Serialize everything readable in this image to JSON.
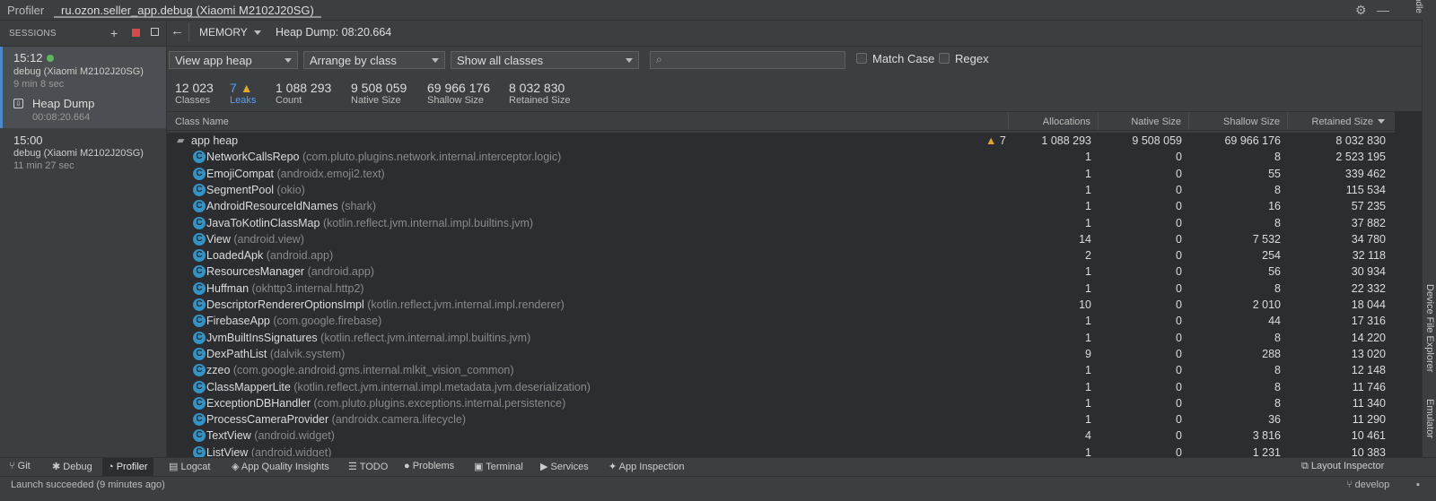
{
  "window": {
    "app_title": "Profiler",
    "tab_title": "ru.ozon.seller_app.debug (Xiaomi M2102J20SG)",
    "right_strip_top": "adle"
  },
  "sessions": {
    "header": "SESSIONS",
    "items": [
      {
        "time": "15:12",
        "device": "debug (Xiaomi M2102J20SG)",
        "duration": "9 min 8 sec",
        "artifact": {
          "label": "Heap Dump",
          "time": "00:08:20.664"
        }
      },
      {
        "time": "15:00",
        "device": "debug (Xiaomi M2102J20SG)",
        "duration": "11 min 27 sec"
      }
    ]
  },
  "toolbar": {
    "profiler_selector": "MEMORY",
    "heap_dump_title": "Heap Dump: 08:20.664"
  },
  "filters": {
    "heap_select": "View app heap",
    "arrange_select": "Arrange by class",
    "classes_select": "Show all classes",
    "search_placeholder": "",
    "match_case": "Match Case",
    "regex": "Regex"
  },
  "stats": [
    {
      "value": "12 023",
      "label": "Classes"
    },
    {
      "value": "7",
      "label": "Leaks"
    },
    {
      "value": "1 088 293",
      "label": "Count"
    },
    {
      "value": "9 508 059",
      "label": "Native Size"
    },
    {
      "value": "69 966 176",
      "label": "Shallow Size"
    },
    {
      "value": "8 032 830",
      "label": "Retained Size"
    }
  ],
  "table": {
    "columns": [
      "Class Name",
      "Allocations",
      "Native Size",
      "Shallow Size",
      "Retained Size"
    ],
    "root": {
      "name": "app heap",
      "leaks": "7",
      "allocations": "1 088 293",
      "native": "9 508 059",
      "shallow": "69 966 176",
      "retained": "8 032 830"
    },
    "rows": [
      {
        "name": "NetworkCallsRepo",
        "pkg": "(com.pluto.plugins.network.internal.interceptor.logic)",
        "allocations": "1",
        "native": "0",
        "shallow": "8",
        "retained": "2 523 195"
      },
      {
        "name": "EmojiCompat",
        "pkg": "(androidx.emoji2.text)",
        "allocations": "1",
        "native": "0",
        "shallow": "55",
        "retained": "339 462"
      },
      {
        "name": "SegmentPool",
        "pkg": "(okio)",
        "allocations": "1",
        "native": "0",
        "shallow": "8",
        "retained": "115 534"
      },
      {
        "name": "AndroidResourceIdNames",
        "pkg": "(shark)",
        "allocations": "1",
        "native": "0",
        "shallow": "16",
        "retained": "57 235"
      },
      {
        "name": "JavaToKotlinClassMap",
        "pkg": "(kotlin.reflect.jvm.internal.impl.builtins.jvm)",
        "allocations": "1",
        "native": "0",
        "shallow": "8",
        "retained": "37 882"
      },
      {
        "name": "View",
        "pkg": "(android.view)",
        "allocations": "14",
        "native": "0",
        "shallow": "7 532",
        "retained": "34 780"
      },
      {
        "name": "LoadedApk",
        "pkg": "(android.app)",
        "allocations": "2",
        "native": "0",
        "shallow": "254",
        "retained": "32 118"
      },
      {
        "name": "ResourcesManager",
        "pkg": "(android.app)",
        "allocations": "1",
        "native": "0",
        "shallow": "56",
        "retained": "30 934"
      },
      {
        "name": "Huffman",
        "pkg": "(okhttp3.internal.http2)",
        "allocations": "1",
        "native": "0",
        "shallow": "8",
        "retained": "22 332"
      },
      {
        "name": "DescriptorRendererOptionsImpl",
        "pkg": "(kotlin.reflect.jvm.internal.impl.renderer)",
        "allocations": "10",
        "native": "0",
        "shallow": "2 010",
        "retained": "18 044"
      },
      {
        "name": "FirebaseApp",
        "pkg": "(com.google.firebase)",
        "allocations": "1",
        "native": "0",
        "shallow": "44",
        "retained": "17 316"
      },
      {
        "name": "JvmBuiltInsSignatures",
        "pkg": "(kotlin.reflect.jvm.internal.impl.builtins.jvm)",
        "allocations": "1",
        "native": "0",
        "shallow": "8",
        "retained": "14 220"
      },
      {
        "name": "DexPathList",
        "pkg": "(dalvik.system)",
        "allocations": "9",
        "native": "0",
        "shallow": "288",
        "retained": "13 020"
      },
      {
        "name": "zzeo",
        "pkg": "(com.google.android.gms.internal.mlkit_vision_common)",
        "allocations": "1",
        "native": "0",
        "shallow": "8",
        "retained": "12 148"
      },
      {
        "name": "ClassMapperLite",
        "pkg": "(kotlin.reflect.jvm.internal.impl.metadata.jvm.deserialization)",
        "allocations": "1",
        "native": "0",
        "shallow": "8",
        "retained": "11 746"
      },
      {
        "name": "ExceptionDBHandler",
        "pkg": "(com.pluto.plugins.exceptions.internal.persistence)",
        "allocations": "1",
        "native": "0",
        "shallow": "8",
        "retained": "11 340"
      },
      {
        "name": "ProcessCameraProvider",
        "pkg": "(androidx.camera.lifecycle)",
        "allocations": "1",
        "native": "0",
        "shallow": "36",
        "retained": "11 290"
      },
      {
        "name": "TextView",
        "pkg": "(android.widget)",
        "allocations": "4",
        "native": "0",
        "shallow": "3 816",
        "retained": "10 461"
      },
      {
        "name": "ListView",
        "pkg": "(android.widget)",
        "allocations": "1",
        "native": "0",
        "shallow": "1 231",
        "retained": "10 383"
      }
    ]
  },
  "right_tools": {
    "device_file_explorer": "Device File Explorer",
    "emulator": "Emulator"
  },
  "bottom_tools": [
    "Git",
    "Debug",
    "Profiler",
    "Logcat",
    "App Quality Insights",
    "TODO",
    "Problems",
    "Terminal",
    "Services",
    "App Inspection",
    "Layout Inspector"
  ],
  "status": {
    "message": "Launch succeeded (9 minutes ago)",
    "branch": "develop"
  },
  "colors": {
    "accent": "#4a88c7",
    "warning": "#e0a72f",
    "class_icon": "#3592c4",
    "live_dot": "#5fb85b"
  }
}
